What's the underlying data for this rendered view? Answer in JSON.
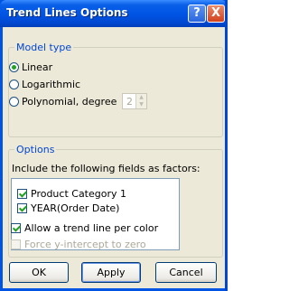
{
  "window": {
    "title": "Trend Lines Options",
    "help_label": "?",
    "close_label": "X"
  },
  "model_type": {
    "legend": "Model type",
    "options": [
      {
        "label": "Linear",
        "selected": true
      },
      {
        "label": "Logarithmic",
        "selected": false
      },
      {
        "label": "Polynomial, degree",
        "selected": false
      }
    ],
    "degree_value": "2"
  },
  "options_group": {
    "legend": "Options",
    "instruction": "Include the following fields as factors:",
    "factors": [
      {
        "label": "Product Category 1",
        "checked": true
      },
      {
        "label": "YEAR(Order Date)",
        "checked": true
      }
    ]
  },
  "settings": {
    "allow_per_color": "Allow a trend line per color",
    "allow_per_color_checked": true,
    "force_zero": "Force y-intercept to zero",
    "force_zero_enabled": false
  },
  "buttons": {
    "ok": "OK",
    "apply": "Apply",
    "cancel": "Cancel"
  }
}
